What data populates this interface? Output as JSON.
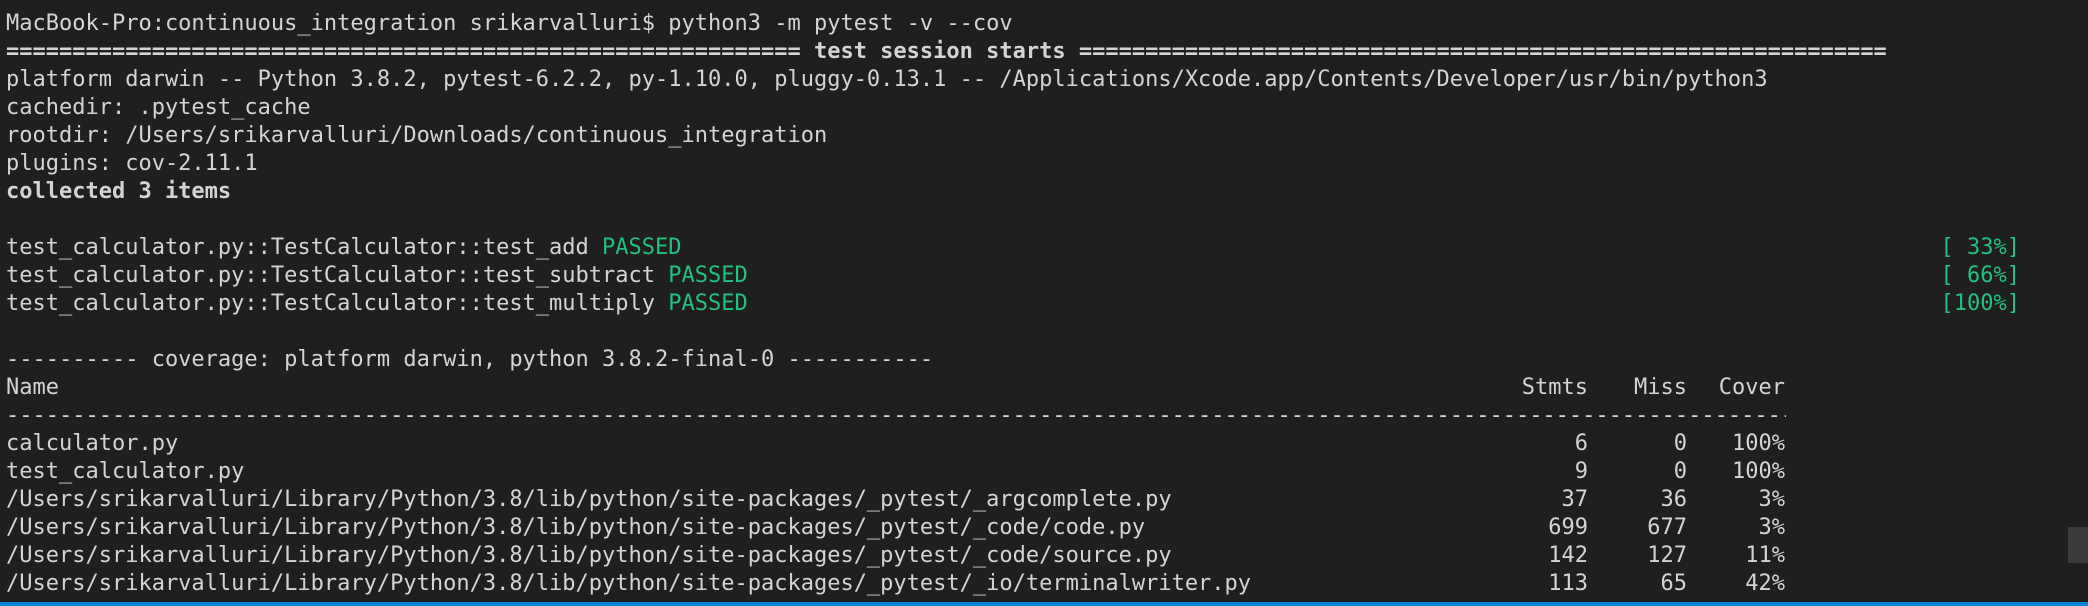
{
  "terminal": {
    "prompt": "MacBook-Pro:continuous_integration srikarvalluri$ python3 -m pytest -v --cov",
    "session_header": "============================================================ test session starts =============================================================",
    "platform": "platform darwin -- Python 3.8.2, pytest-6.2.2, py-1.10.0, pluggy-0.13.1 -- /Applications/Xcode.app/Contents/Developer/usr/bin/python3",
    "cachedir": "cachedir: .pytest_cache",
    "rootdir": "rootdir: /Users/srikarvalluri/Downloads/continuous_integration",
    "plugins": "plugins: cov-2.11.1",
    "collected": "collected 3 items",
    "tests": [
      {
        "name": "test_calculator.py::TestCalculator::test_add",
        "status": "PASSED",
        "progress": "[ 33%]"
      },
      {
        "name": "test_calculator.py::TestCalculator::test_subtract",
        "status": "PASSED",
        "progress": "[ 66%]"
      },
      {
        "name": "test_calculator.py::TestCalculator::test_multiply",
        "status": "PASSED",
        "progress": "[100%]"
      }
    ],
    "coverage_header": "---------- coverage: platform darwin, python 3.8.2-final-0 -----------",
    "coverage_table": {
      "headers": {
        "name": "Name",
        "stmts": "Stmts",
        "miss": "Miss",
        "cover": "Cover"
      },
      "rule": "-------------------------------------------------------------------------------------------------------------------------------------------------",
      "rows": [
        {
          "name": "calculator.py",
          "stmts": "6",
          "miss": "0",
          "cover": "100%"
        },
        {
          "name": "test_calculator.py",
          "stmts": "9",
          "miss": "0",
          "cover": "100%"
        },
        {
          "name": "/Users/srikarvalluri/Library/Python/3.8/lib/python/site-packages/_pytest/_argcomplete.py",
          "stmts": "37",
          "miss": "36",
          "cover": "3%"
        },
        {
          "name": "/Users/srikarvalluri/Library/Python/3.8/lib/python/site-packages/_pytest/_code/code.py",
          "stmts": "699",
          "miss": "677",
          "cover": "3%"
        },
        {
          "name": "/Users/srikarvalluri/Library/Python/3.8/lib/python/site-packages/_pytest/_code/source.py",
          "stmts": "142",
          "miss": "127",
          "cover": "11%"
        },
        {
          "name": "/Users/srikarvalluri/Library/Python/3.8/lib/python/site-packages/_pytest/_io/terminalwriter.py",
          "stmts": "113",
          "miss": "65",
          "cover": "42%"
        }
      ]
    },
    "colors": {
      "background": "#1f1f1f",
      "text": "#d4d4d4",
      "passed": "#23c07f",
      "accent": "#0a84d6"
    }
  }
}
